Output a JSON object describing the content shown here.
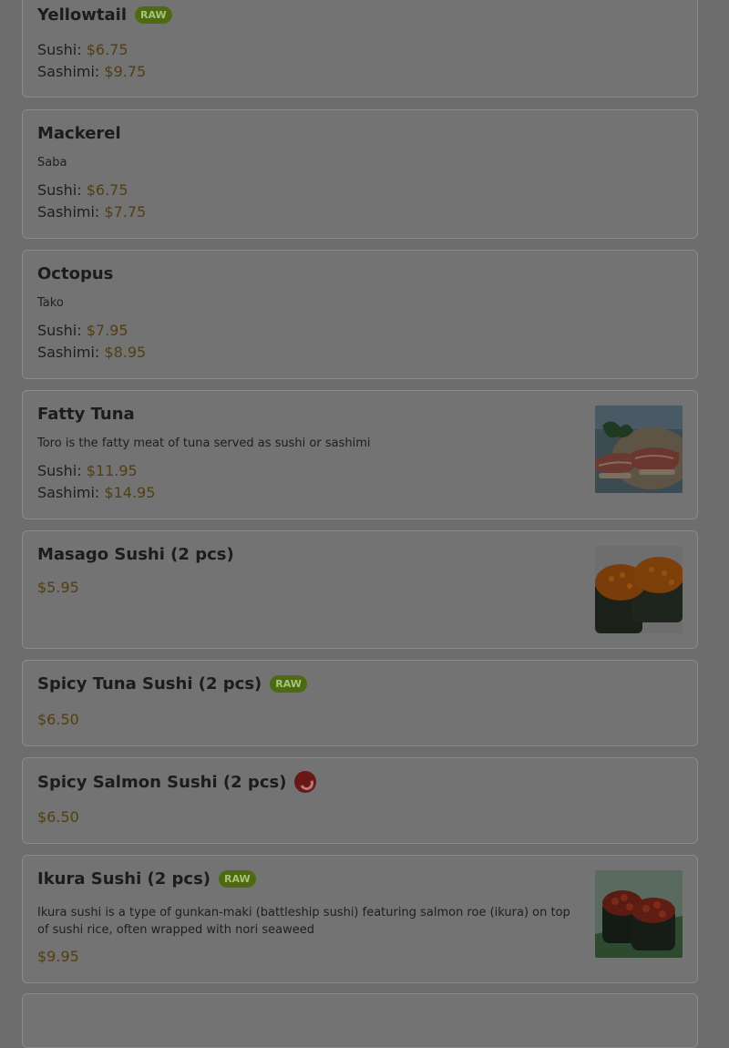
{
  "badges": {
    "raw": "RAW"
  },
  "items": [
    {
      "name": "Yellowtail",
      "raw": true,
      "sushi_label": "Sushi:",
      "sushi_price": "$6.75",
      "sashimi_label": "Sashimi:",
      "sashimi_price": "$9.75"
    },
    {
      "name": "Mackerel",
      "description": "Saba",
      "sushi_label": "Sushi:",
      "sushi_price": "$6.75",
      "sashimi_label": "Sashimi:",
      "sashimi_price": "$7.75"
    },
    {
      "name": "Octopus",
      "description": "Tako",
      "sushi_label": "Sushi:",
      "sushi_price": "$7.95",
      "sashimi_label": "Sashimi:",
      "sashimi_price": "$8.95"
    },
    {
      "name": "Fatty Tuna",
      "description": "Toro is the fatty meat of tuna served as sushi or sashimi",
      "sushi_label": "Sushi:",
      "sushi_price": "$11.95",
      "sashimi_label": "Sashimi:",
      "sashimi_price": "$14.95",
      "image": "fatty-tuna-photo"
    },
    {
      "name": "Masago Sushi (2 pcs)",
      "price": "$5.95",
      "image": "masago-sushi-photo"
    },
    {
      "name": "Spicy Tuna Sushi (2 pcs)",
      "raw": true,
      "price": "$6.50"
    },
    {
      "name": "Spicy Salmon Sushi (2 pcs)",
      "spicy_icon": "chili-pepper-icon",
      "price": "$6.50"
    },
    {
      "name": "Ikura Sushi (2 pcs)",
      "raw": true,
      "description": "Ikura sushi is a type of gunkan-maki (battleship sushi) featuring salmon roe (ikura) on top of sushi rice, often wrapped with nori seaweed",
      "price": "$9.95",
      "image": "ikura-sushi-photo"
    }
  ]
}
